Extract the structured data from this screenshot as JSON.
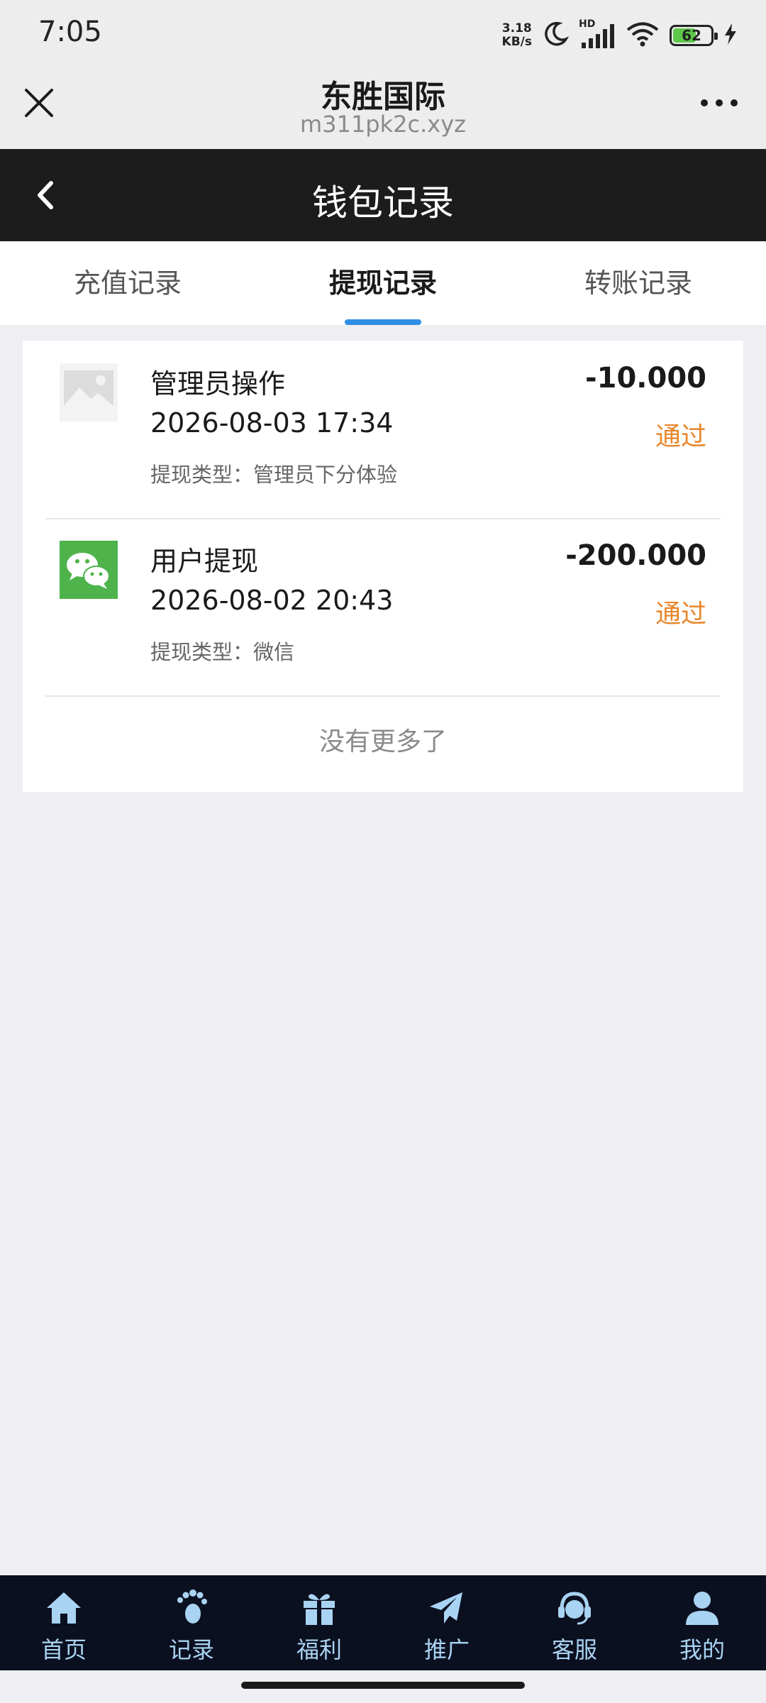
{
  "status_bar": {
    "time": "7:05",
    "net_speed_value": "3.18",
    "net_speed_unit": "KB/s",
    "network": "HD",
    "battery_level": "62",
    "battery_fraction": 0.62,
    "icons": [
      "moon-icon",
      "signal-icon",
      "wifi-icon",
      "battery-icon",
      "charging-icon"
    ]
  },
  "browser": {
    "title": "东胜国际",
    "url": "m311pk2c.xyz",
    "icons": [
      "close-icon",
      "more-icon"
    ]
  },
  "page": {
    "title": "钱包记录"
  },
  "tabs": [
    {
      "label": "充值记录",
      "active": false
    },
    {
      "label": "提现记录",
      "active": true
    },
    {
      "label": "转账记录",
      "active": false
    }
  ],
  "colors": {
    "accent": "#2f8fe6",
    "status_passed": "#e8862a",
    "header_dark": "#1c1c1c",
    "nav_bg": "#0b1020",
    "nav_fg": "#a9d3f2",
    "wechat_green": "#4db34a"
  },
  "records": [
    {
      "icon": "image-placeholder-icon",
      "name": "管理员操作",
      "time": "2026-08-03 17:34",
      "type": "提现类型：管理员下分体验",
      "amount": "-10.000",
      "status": "通过"
    },
    {
      "icon": "wechat-icon",
      "name": "用户提现",
      "time": "2026-08-02 20:43",
      "type": "提现类型：微信",
      "amount": "-200.000",
      "status": "通过"
    }
  ],
  "list_end": "没有更多了",
  "bottom_nav": [
    {
      "label": "首页",
      "icon": "home-icon"
    },
    {
      "label": "记录",
      "icon": "footprint-icon"
    },
    {
      "label": "福利",
      "icon": "gift-icon"
    },
    {
      "label": "推广",
      "icon": "paper-plane-icon"
    },
    {
      "label": "客服",
      "icon": "headset-icon"
    },
    {
      "label": "我的",
      "icon": "user-icon"
    }
  ]
}
